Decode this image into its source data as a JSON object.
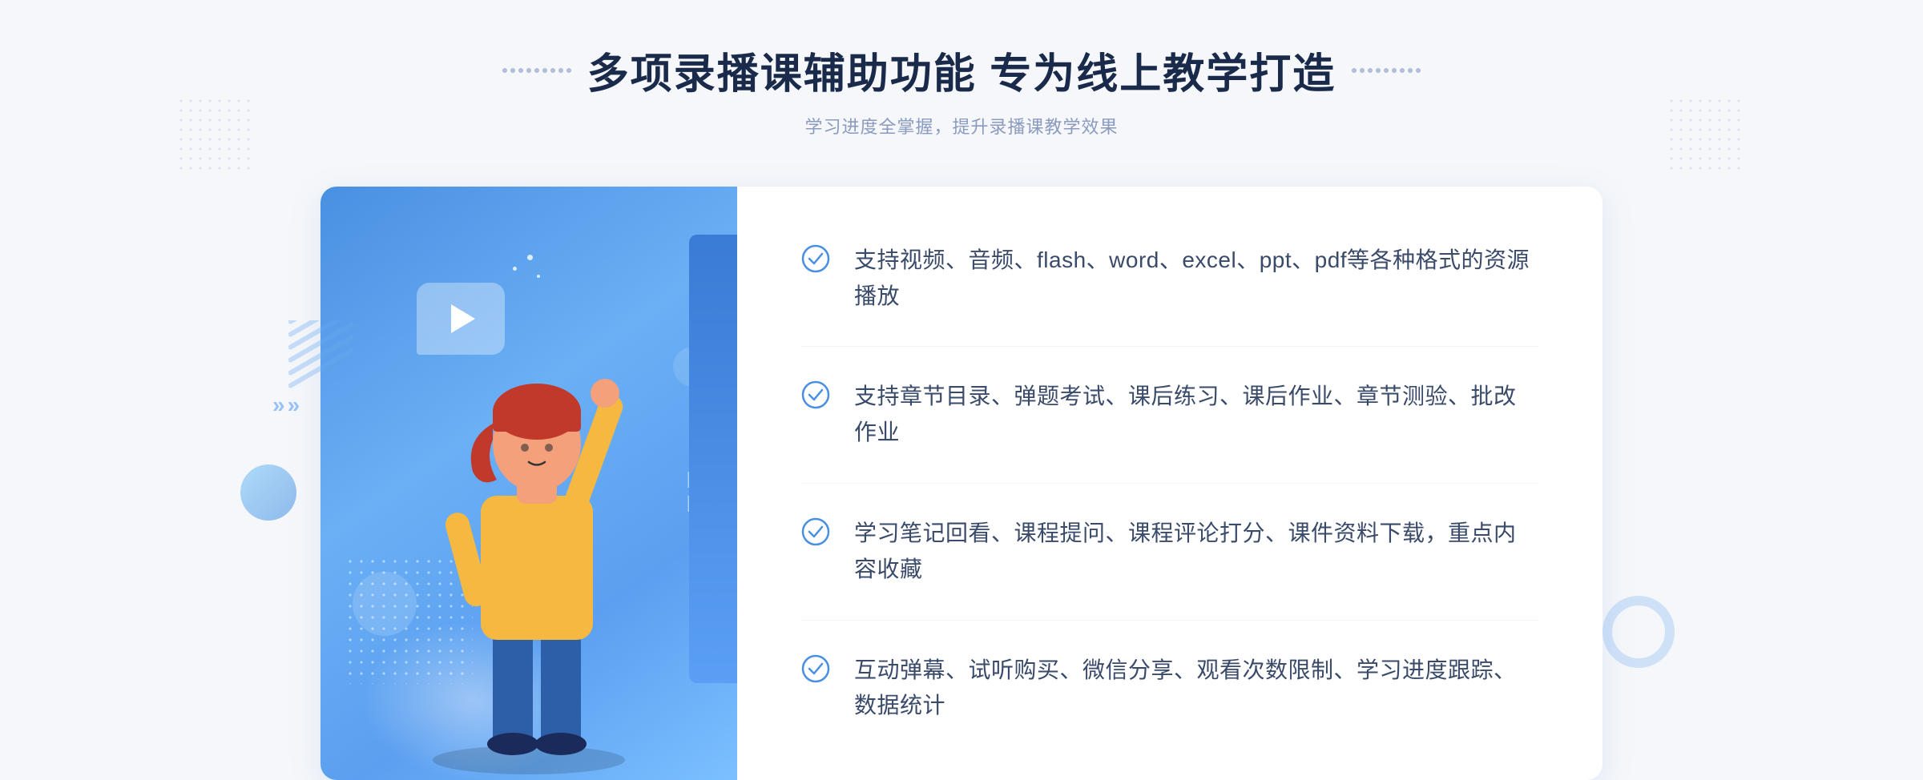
{
  "header": {
    "title": "多项录播课辅助功能 专为线上教学打造",
    "subtitle": "学习进度全掌握，提升录播课教学效果",
    "title_part1": "多项录播课辅助功能",
    "title_part2": "专为线上教学打造"
  },
  "features": [
    {
      "id": 1,
      "text": "支持视频、音频、flash、word、excel、ppt、pdf等各种格式的资源播放"
    },
    {
      "id": 2,
      "text": "支持章节目录、弹题考试、课后练习、课后作业、章节测验、批改作业"
    },
    {
      "id": 3,
      "text": "学习笔记回看、课程提问、课程评论打分、课件资料下载，重点内容收藏"
    },
    {
      "id": 4,
      "text": "互动弹幕、试听购买、微信分享、观看次数限制、学习进度跟踪、数据统计"
    }
  ],
  "colors": {
    "primary_blue": "#4a90e2",
    "light_blue": "#6ab0f5",
    "title_dark": "#1a2a4a",
    "text_color": "#3a4a6a",
    "subtitle_color": "#8a9bbf",
    "check_color": "#4a90e2"
  },
  "icons": {
    "left_arrows": "«",
    "play": "▶"
  }
}
